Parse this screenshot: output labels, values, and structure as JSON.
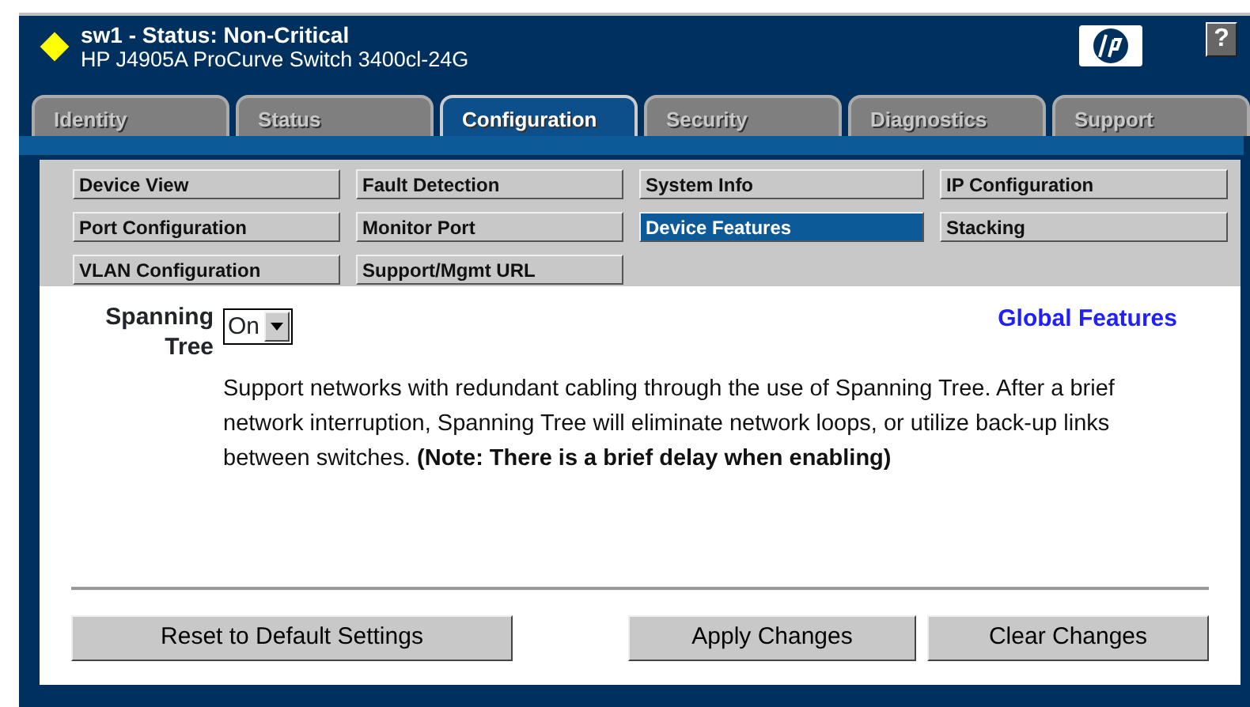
{
  "header": {
    "color": "#ffff00",
    "title": "sw1 - Status:  Non-Critical",
    "subtitle": "HP J4905A ProCurve Switch 3400cl-24G",
    "help": "?"
  },
  "tabs": [
    {
      "label": "Identity",
      "selected": false
    },
    {
      "label": "Status",
      "selected": false
    },
    {
      "label": "Configuration",
      "selected": true
    },
    {
      "label": "Security",
      "selected": false
    },
    {
      "label": "Diagnostics",
      "selected": false
    },
    {
      "label": "Support",
      "selected": false
    }
  ],
  "subnav": [
    {
      "label": "Device View",
      "selected": false
    },
    {
      "label": "Fault Detection",
      "selected": false
    },
    {
      "label": "System Info",
      "selected": false
    },
    {
      "label": "IP Configuration",
      "selected": false
    },
    {
      "label": "Port Configuration",
      "selected": false
    },
    {
      "label": "Monitor Port",
      "selected": false
    },
    {
      "label": "Device Features",
      "selected": true
    },
    {
      "label": "Stacking",
      "selected": false
    },
    {
      "label": "VLAN Configuration",
      "selected": false
    },
    {
      "label": "Support/Mgmt URL",
      "selected": false
    }
  ],
  "content": {
    "field_label": "Spanning Tree",
    "field_value": "On",
    "heading": "Global Features",
    "description": "Support networks with redundant cabling through the use of Spanning Tree. After a brief network interruption, Spanning Tree will eliminate network loops, or utilize back-up links between switches. **(Note: There is a brief delay when enabling)**"
  },
  "buttons": [
    "Reset to Default Settings",
    "Apply Changes",
    "Clear Changes"
  ]
}
